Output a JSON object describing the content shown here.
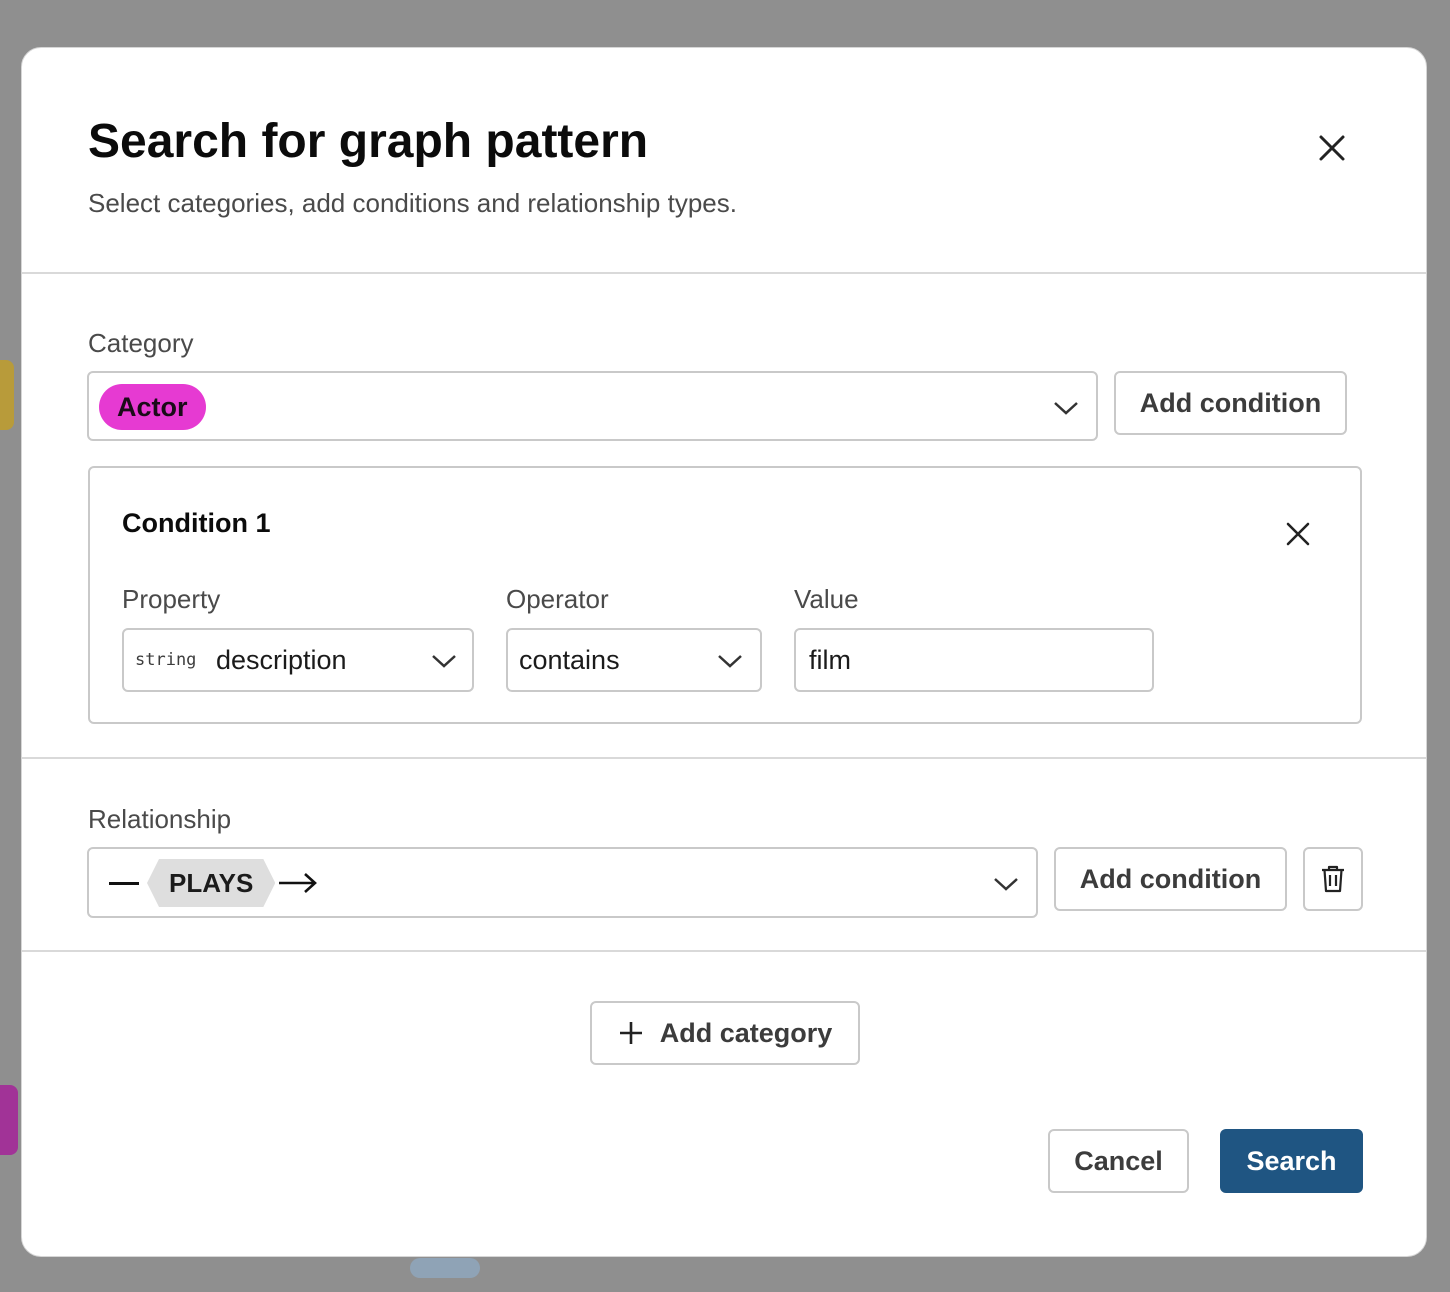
{
  "modal": {
    "title": "Search for graph pattern",
    "subtitle": "Select categories, add conditions and relationship types."
  },
  "category": {
    "label": "Category",
    "selected_chip": "Actor",
    "chip_color": "#e63ad2",
    "add_condition_label": "Add condition"
  },
  "condition": {
    "title": "Condition 1",
    "property_label": "Property",
    "property_type": "string",
    "property_value": "description",
    "operator_label": "Operator",
    "operator_value": "contains",
    "value_label": "Value",
    "value_value": "film"
  },
  "relationship": {
    "label": "Relationship",
    "type": "PLAYS",
    "add_condition_label": "Add condition"
  },
  "actions": {
    "add_category_label": "Add category",
    "cancel_label": "Cancel",
    "search_label": "Search"
  },
  "colors": {
    "primary": "#1f5582",
    "backdrop": "#8f8f8f"
  },
  "icons": {
    "close": "close-icon",
    "chevron": "chevron-down-icon",
    "trash": "trash-icon",
    "plus": "plus-icon",
    "arrow": "arrow-right-icon"
  }
}
